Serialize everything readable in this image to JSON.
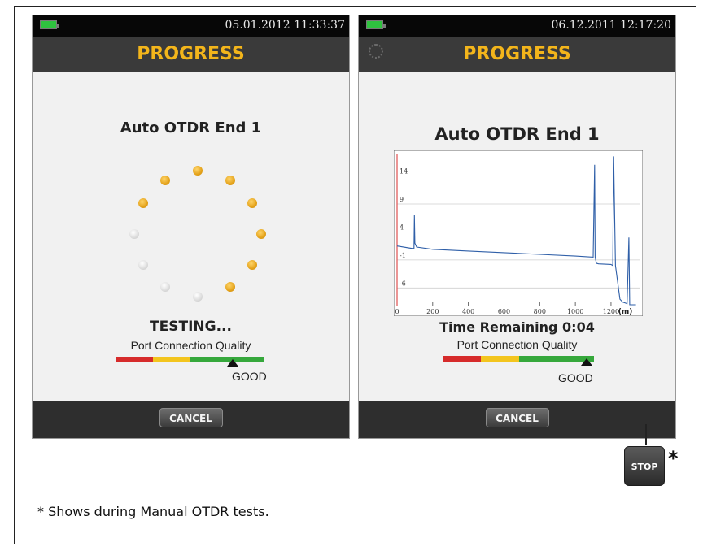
{
  "left_screen": {
    "datetime": "05.01.2012 11:33:37",
    "title": "PROGRESS",
    "test_name": "Auto OTDR End 1",
    "status": "TESTING...",
    "quality_label": "Port Connection Quality",
    "quality_value": "GOOD",
    "cancel_label": "CANCEL"
  },
  "right_screen": {
    "datetime": "06.12.2011 12:17:20",
    "title": "PROGRESS",
    "test_name": "Auto OTDR End 1",
    "status": "Time Remaining 0:04",
    "quality_label": "Port Connection Quality",
    "quality_value": "GOOD",
    "cancel_label": "CANCEL"
  },
  "stop_button": {
    "label": "STOP",
    "marker": "*"
  },
  "footnote": "* Shows during Manual OTDR tests.",
  "colors": {
    "title": "#f3b51b",
    "battery": "#2fc23f",
    "trace": "#2f5fa8"
  },
  "chart_data": {
    "type": "line",
    "xlabel": "(m)",
    "xlim": [
      0,
      1360
    ],
    "ylim": [
      -9,
      18
    ],
    "x_ticks": [
      "0",
      "200",
      "400",
      "600",
      "800",
      "1000",
      "1200"
    ],
    "y_ticks": [
      "14",
      "9",
      "4",
      "-1",
      "-6"
    ],
    "series": [
      {
        "x": [
          0,
          95,
          97,
          100,
          110,
          200,
          400,
          600,
          800,
          1000,
          1100,
          1108,
          1111,
          1118,
          1130,
          1200,
          1210,
          1215,
          1225,
          1250,
          1265,
          1290,
          1300,
          1305,
          1340
        ],
        "y": [
          1.5,
          1.0,
          7.0,
          2.0,
          1.3,
          0.9,
          0.6,
          0.3,
          0.0,
          -0.3,
          -0.5,
          16.0,
          -0.5,
          -1.6,
          -1.7,
          -1.8,
          -2.0,
          17.5,
          -2.0,
          -8.0,
          -8.5,
          -8.8,
          3.0,
          -9.0,
          -9.0
        ]
      }
    ]
  }
}
